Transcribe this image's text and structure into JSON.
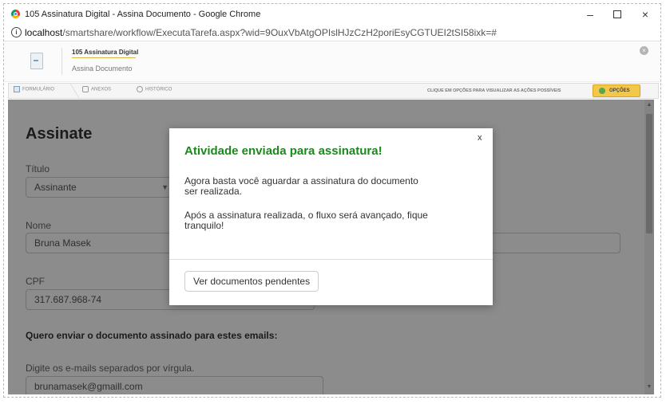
{
  "browser": {
    "window_title": "105 Assinatura Digital - Assina Documento - Google Chrome",
    "url_host": "localhost",
    "url_path": "/smartshare/workflow/ExecutaTarefa.aspx?wid=9OuxVbAtgOPIslHJzCzH2poriEsyCGTUEI2tSI58ixk=#",
    "controls": {
      "minimize": "–",
      "close": "×"
    }
  },
  "app": {
    "title": "105 Assinatura Digital",
    "subtitle": "Assina Documento",
    "close_glyph": "×"
  },
  "tabs": {
    "items": [
      {
        "label": "FORMULÁRIO"
      },
      {
        "label": "ANEXOS"
      },
      {
        "label": "HISTÓRICO"
      }
    ],
    "hint": "CLIQUE EM OPÇÕES PARA VISUALIZAR AS AÇÕES POSSÍVEIS",
    "options_label": "OPÇÕES"
  },
  "form": {
    "title": "Assinate",
    "titulo_label": "Título",
    "titulo_value": "Assinante",
    "nome_label": "Nome",
    "nome_value": "Bruna Masek",
    "cpf_label": "CPF",
    "cpf_value": "317.687.968-74",
    "emails_heading": "Quero enviar o documento assinado para estes emails:",
    "emails_label": "Digite os e-mails separados por vírgula.",
    "emails_value": "brunamasek@gmaill.com"
  },
  "modal": {
    "close": "x",
    "title": "Atividade enviada para assinatura!",
    "paragraph1": "Agora basta você aguardar a assinatura do documento ser realizada.",
    "paragraph2": "Após a assinatura realizada, o fluxo será avançado, fique tranquilo!",
    "button_label": "Ver documentos pendentes"
  },
  "colors": {
    "modal_title": "#1a8a1a",
    "options_button": "#f3c74a"
  }
}
